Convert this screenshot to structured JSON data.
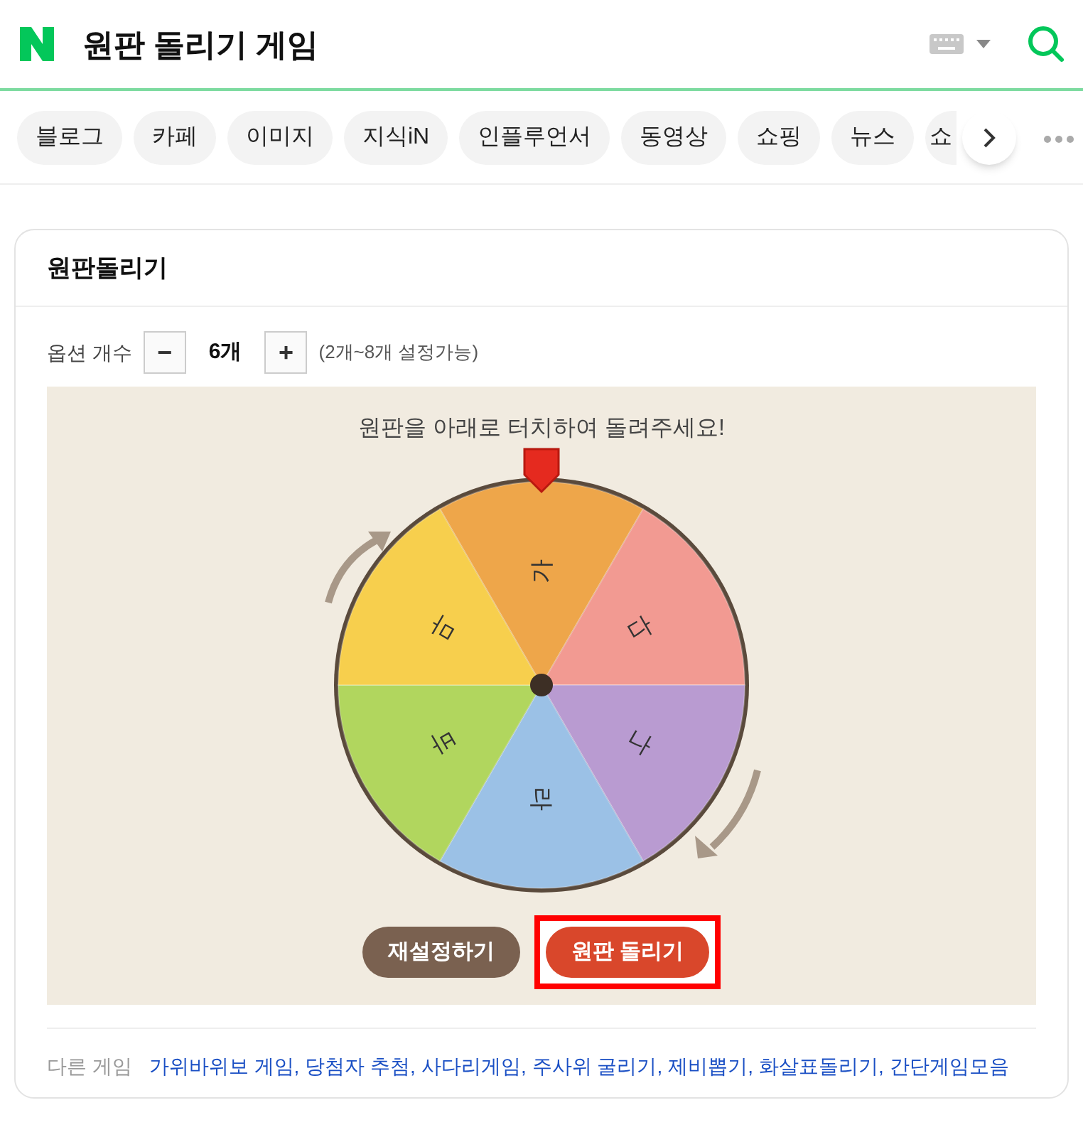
{
  "header": {
    "title": "원판 돌리기 게임"
  },
  "tabs": [
    {
      "label": "블로그"
    },
    {
      "label": "카페"
    },
    {
      "label": "이미지"
    },
    {
      "label": "지식iN"
    },
    {
      "label": "인플루언서"
    },
    {
      "label": "동영상"
    },
    {
      "label": "쇼핑"
    },
    {
      "label": "뉴스"
    },
    {
      "label": "쇼"
    }
  ],
  "card": {
    "title": "원판돌리기",
    "options": {
      "label": "옵션 개수",
      "minus": "−",
      "count": "6개",
      "plus": "+",
      "hint": "(2개~8개 설정가능)"
    },
    "game": {
      "instruction": "원판을 아래로 터치하여 돌려주세요!",
      "segments": [
        {
          "label": "가",
          "color": "#eea64a"
        },
        {
          "label": "다",
          "color": "#f29a92"
        },
        {
          "label": "나",
          "color": "#b99bd1"
        },
        {
          "label": "라",
          "color": "#9bc1e6"
        },
        {
          "label": "바",
          "color": "#b1d65e"
        },
        {
          "label": "마",
          "color": "#f7cf4d"
        }
      ],
      "buttons": [
        {
          "label": "재설정하기",
          "kind": "reset",
          "highlighted": false
        },
        {
          "label": "원판 돌리기",
          "kind": "spin",
          "highlighted": true
        }
      ]
    },
    "other_games": {
      "label": "다른 게임",
      "links": [
        "가위바위보 게임,",
        "당첨자 추첨,",
        "사다리게임,",
        "주사위 굴리기,",
        "제비뽑기,",
        "화살표돌리기,",
        "간단게임모음"
      ]
    }
  }
}
